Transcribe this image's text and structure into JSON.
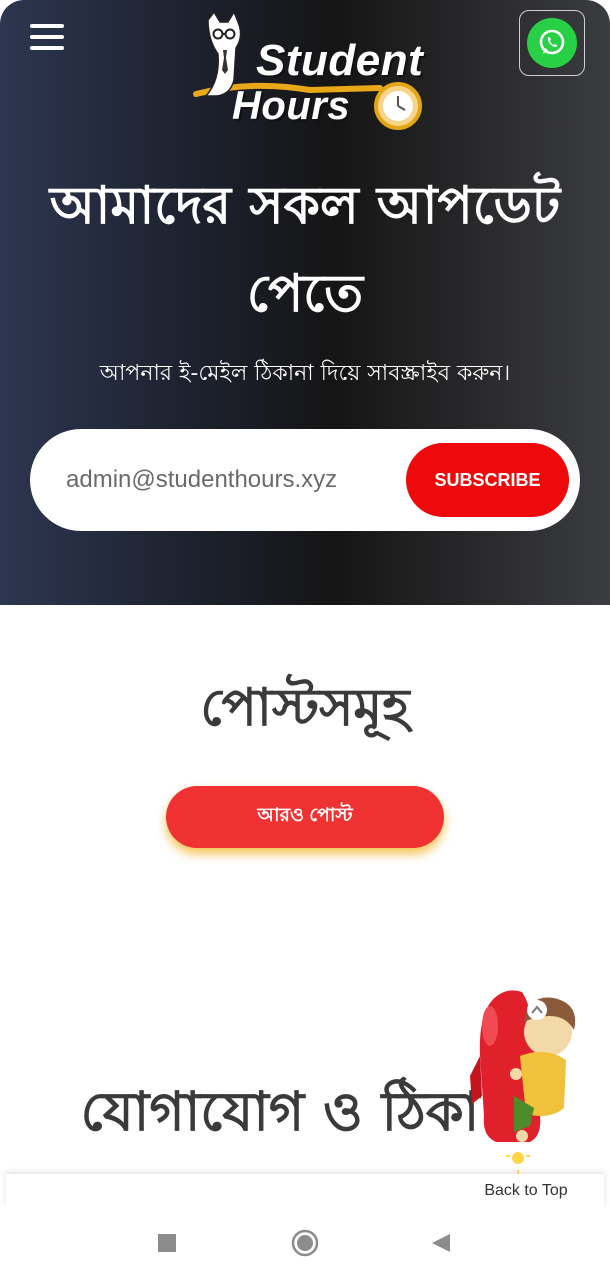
{
  "header": {
    "logo_word_1": "Student",
    "logo_word_2": "Hours",
    "whatsapp_color": "#27d045"
  },
  "hero": {
    "title_line1": "আমাদের সকল আপডেট",
    "title_line2": "পেতে",
    "subtitle": "আপনার ই-মেইল ঠিকানা দিয়ে সাবস্ক্রাইব করুন।",
    "email_value": "admin@studenthours.xyz",
    "subscribe_label": "SUBSCRIBE",
    "accent_color": "#ee0a0a"
  },
  "posts": {
    "title": "পোস্টসমূহ",
    "more_label": "আরও পোস্ট"
  },
  "contact": {
    "title": "যোগাযোগ ও ঠিকা"
  },
  "back_to_top": {
    "label": "Back to Top"
  },
  "navbar": {
    "icons": [
      "square-icon",
      "circle-icon",
      "back-triangle-icon"
    ]
  }
}
